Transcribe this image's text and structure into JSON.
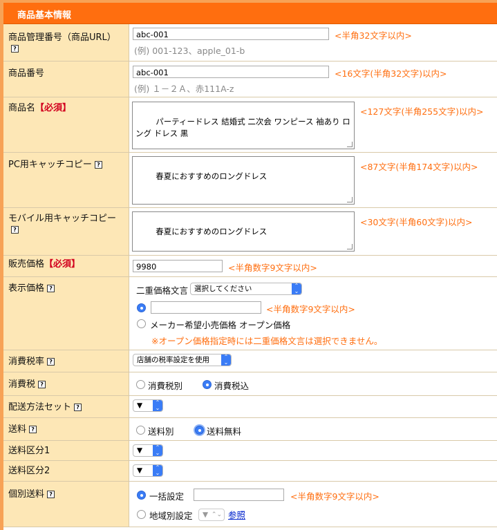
{
  "section_title": "商品基本情報",
  "rows": {
    "mgmt": {
      "label": "商品管理番号（商品URL）",
      "value": "abc-001",
      "note": "<半角32文字以内>",
      "example": "(例) 001-123、apple_01-b"
    },
    "number": {
      "label": "商品番号",
      "value": "abc-001",
      "note": "<16文字(半角32文字)以内>",
      "example": "(例) １－２Ａ、赤111A-z"
    },
    "name": {
      "label": "商品名",
      "required": "【必須】",
      "value": "パーティードレス 結婚式 二次会 ワンピース 袖あり ロング ドレス 黒",
      "note": "<127文字(半角255文字)以内>"
    },
    "pc_catch": {
      "label": "PC用キャッチコピー",
      "value": "春夏におすすめのロングドレス",
      "note": "<87文字(半角174文字)以内>"
    },
    "mobile_catch": {
      "label": "モバイル用キャッチコピー",
      "value": "春夏におすすめのロングドレス",
      "note": "<30文字(半角60文字)以内>"
    },
    "price": {
      "label": "販売価格",
      "required": "【必須】",
      "value": "9980",
      "note": "<半角数字9文字以内>"
    },
    "display_price": {
      "label": "表示価格",
      "double_label": "二重価格文言",
      "double_select": "選択してください",
      "input_value": "",
      "note": "<半角数字9文字以内>",
      "open_price_label": "メーカー希望小売価格 オープン価格",
      "warning": "※オープン価格指定時には二重価格文言は選択できません。"
    },
    "tax_rate": {
      "label": "消費税率",
      "select": "店舗の税率設定を使用"
    },
    "tax": {
      "label": "消費税",
      "opt1": "消費税別",
      "opt2": "消費税込"
    },
    "delivery_set": {
      "label": "配送方法セット",
      "select": "▼"
    },
    "shipping": {
      "label": "送料",
      "opt1": "送料別",
      "opt2": "送料無料"
    },
    "ship_class1": {
      "label": "送料区分1",
      "select": "▼"
    },
    "ship_class2": {
      "label": "送料区分2",
      "select": "▼"
    },
    "individual": {
      "label": "個別送料",
      "opt1": "一括設定",
      "input_value": "",
      "note": "<半角数字9文字以内>",
      "opt2": "地域別設定",
      "select": "▼",
      "link": "参照"
    }
  },
  "colors": {
    "accent": "#ff6e0f",
    "label_bg": "#fde7b6",
    "select_blue": "#3a7cf6"
  }
}
